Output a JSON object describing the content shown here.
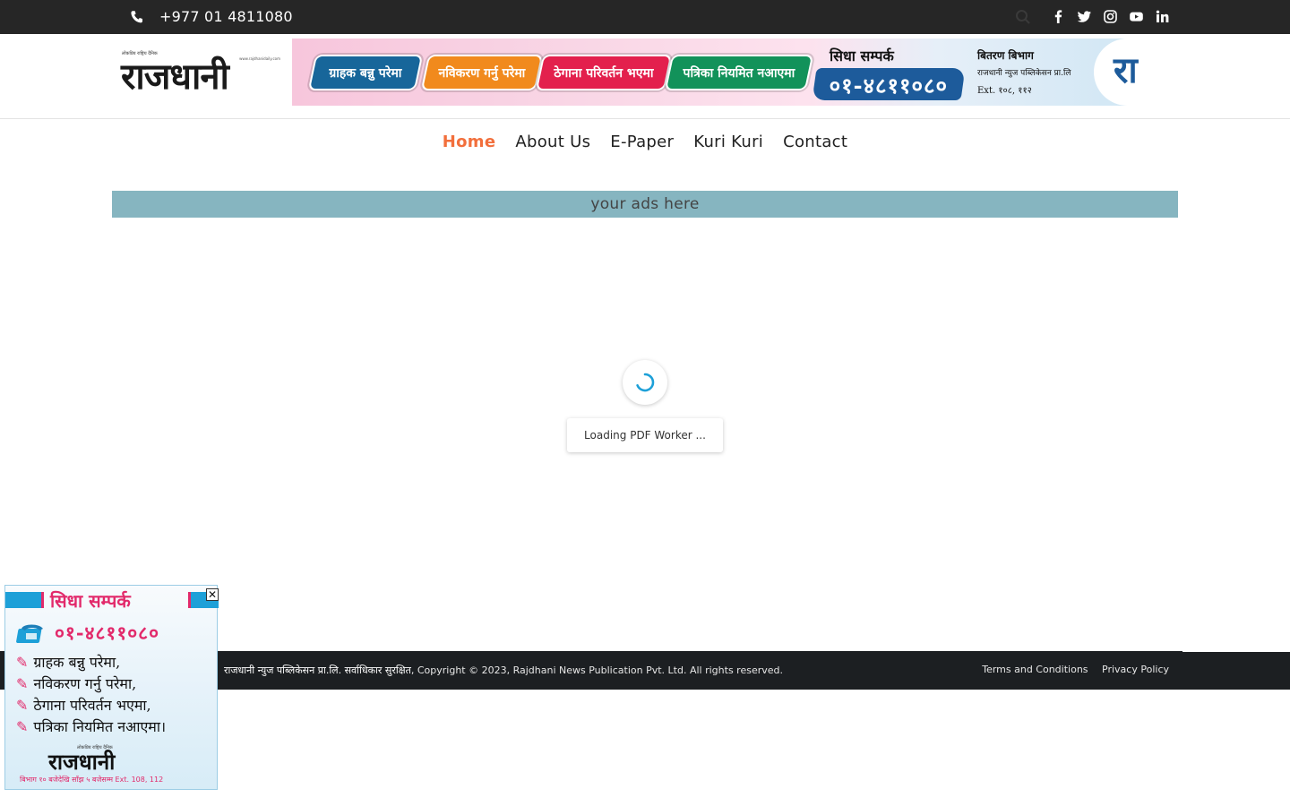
{
  "topbar": {
    "phone": "+977 01 4811080",
    "icons": [
      "phone-icon",
      "search-icon",
      "facebook-icon",
      "twitter-icon",
      "instagram-icon",
      "youtube-icon",
      "linkedin-icon"
    ]
  },
  "header": {
    "logo_text": "राजधानी",
    "logo_tagline": "लोकप्रिय राष्ट्रिय दैनिक",
    "logo_url": "www.rajdhanidaily.com",
    "banner": {
      "pills": [
        "ग्राहक बन्नु परेमा",
        "नविकरण गर्नु परेमा",
        "ठेगाना परिवर्तन भएमा",
        "पत्रिका नियमित नआएमा"
      ],
      "contact_label": "सिधा सम्पर्क",
      "contact_number": "०१-४८११०८०",
      "distribution": "बितरण बिभाग",
      "publisher": "राजधानी न्युज पब्लिकेसन प्रा.लि",
      "extension": "Ext. १०८, ११२",
      "logo_glyph": "रा"
    }
  },
  "nav": {
    "items": [
      "Home",
      "About Us",
      "E-Paper",
      "Kuri Kuri",
      "Contact"
    ],
    "active": "Home"
  },
  "ad_strip": {
    "text": "your ads here"
  },
  "loader": {
    "text": "Loading PDF Worker ..."
  },
  "footer": {
    "nepali_text": "राजधानी न्युज पब्लिकेसन प्रा.लि. सर्वाधिकार सुरक्षित",
    "copyright": ", Copyright © 2023, Rajdhani News Publication Pvt. Ltd. All rights reserved.",
    "links": [
      "Terms and Conditions",
      "Privacy Policy"
    ]
  },
  "floating_ad": {
    "title": "सिधा सम्पर्क",
    "number": "०१-४८११०८०",
    "lines": [
      "ग्राहक बन्नु परेमा,",
      "नविकरण गर्नु परेमा,",
      "ठेगाना परिवर्तन भएमा,",
      "पत्रिका नियमित नआएमा।"
    ],
    "logo_tagline": "लोकप्रिय राष्ट्रिय दैनिक",
    "logo_text": "राजधानी",
    "bottom_text": "बिभाग १० बजेदेखि साँझ ५ बजेसम्म Ext. 108, 112",
    "close_label": "✕"
  },
  "colors": {
    "topbar_bg": "#262626",
    "nav_active": "#f26f3c",
    "ad_strip_bg": "#86b5c0",
    "footer_bg": "#1c1f22",
    "spinner": "#1da0d8"
  }
}
